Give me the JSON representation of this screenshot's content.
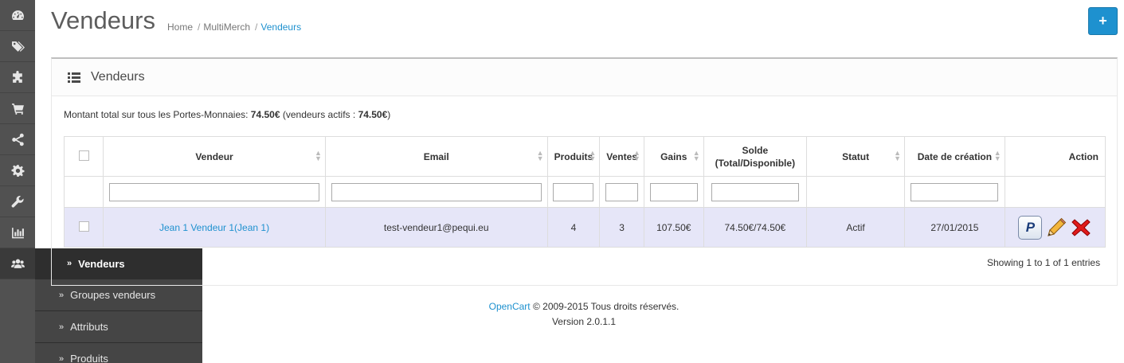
{
  "page": {
    "title": "Vendeurs"
  },
  "breadcrumb": [
    "Home",
    "MultiMerch",
    "Vendeurs"
  ],
  "add_button": {
    "label": "+"
  },
  "sidebar": {
    "icons": [
      "dashboard-icon",
      "tags-icon",
      "puzzle-icon",
      "cart-icon",
      "share-icon",
      "gear-icon",
      "wrench-icon",
      "bar-chart-icon",
      "users-icon"
    ],
    "flyout": {
      "active": "Vendeurs",
      "items": [
        "Groupes vendeurs",
        "Attributs",
        "Produits"
      ]
    }
  },
  "panel": {
    "title": "Vendeurs",
    "total_prefix": "Montant total sur tous les Portes-Monnaies:",
    "total_value": "74.50€",
    "total_mid": "(vendeurs actifs :",
    "total_active": "74.50€",
    "total_suffix": ")"
  },
  "table": {
    "columns": [
      "Vendeur",
      "Email",
      "Produits",
      "Ventes",
      "Gains",
      "Solde (Total/Disponible)",
      "Statut",
      "Date de création",
      "Action"
    ],
    "rows": [
      {
        "vendeur": "Jean 1 Vendeur 1(Jean 1)",
        "email": "test-vendeur1@pequi.eu",
        "produits": "4",
        "ventes": "3",
        "gains": "107.50€",
        "solde": "74.50€/74.50€",
        "statut": "Actif",
        "date": "27/01/2015"
      }
    ],
    "showing": "Showing 1 to 1 of 1 entries"
  },
  "footer": {
    "brand": "OpenCart",
    "copyright": "© 2009-2015 Tous droits réservés.",
    "version": "Version 2.0.1.1"
  },
  "colors": {
    "accent": "#1e91cf",
    "sidebar": "#515151",
    "row_highlight": "#e6e6f8"
  }
}
